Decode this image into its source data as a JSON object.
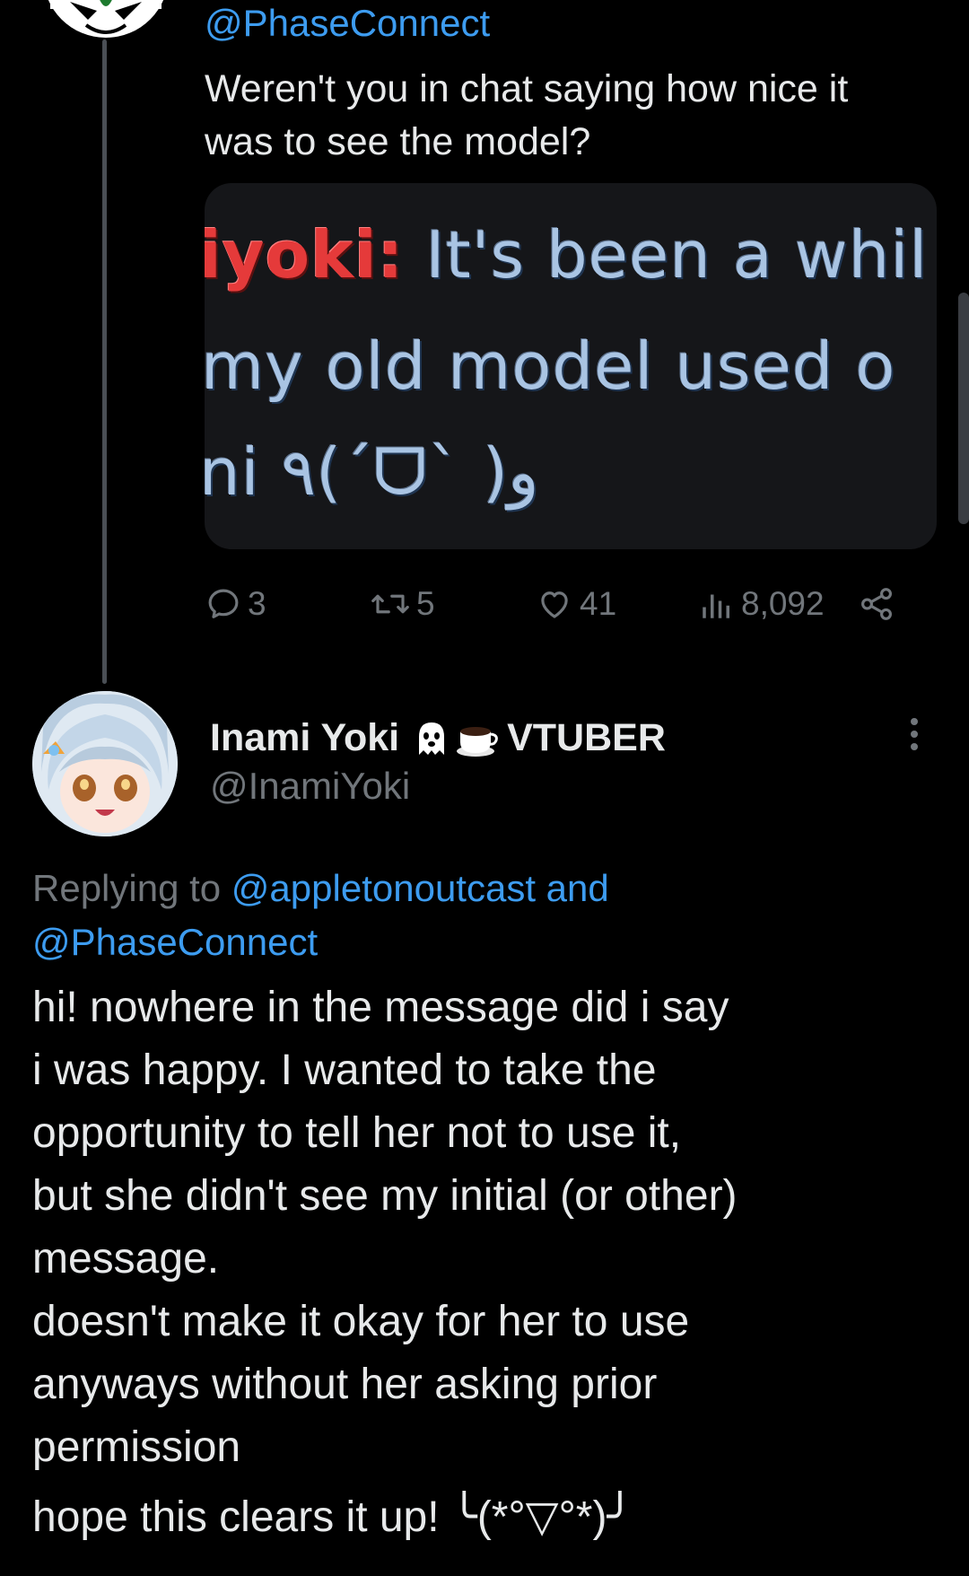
{
  "parent_tweet": {
    "handle": "@PhaseConnect",
    "text_lines": [
      "Weren't you in chat saying how nice it",
      "was to see the model?"
    ],
    "media": {
      "chat_name": "iyoki:",
      "line1_text": " It's been a whil",
      "line2_text": " my old model used o",
      "line3_text": "ni ٩(ˊᗜˋ )و"
    },
    "actions": {
      "replies": "3",
      "reposts": "5",
      "likes": "41",
      "views": "8,092"
    }
  },
  "reply_tweet": {
    "display_name": "Inami Yoki",
    "name_suffix": "VTUBER",
    "name_emojis": [
      "ghost-icon",
      "coffee-icon"
    ],
    "handle": "@InamiYoki",
    "replying_prefix": "Replying to ",
    "replying_to_1": "@appletonoutcast",
    "replying_and": " and",
    "replying_to_2": "@PhaseConnect",
    "text_lines": [
      "hi! nowhere in the message did i say",
      "i was happy. I wanted to take the",
      "opportunity to tell her not to use it,",
      "but she didn't see my initial (or other)",
      "message.",
      "doesn't make it okay for her to use",
      "anyways without her asking prior",
      "permission",
      "hope this clears it up!  ╰(*°▽°*)╯"
    ]
  },
  "colors": {
    "background": "#000000",
    "text_primary": "#e7e9ea",
    "text_secondary": "#71767b",
    "link": "#3d9cf0",
    "card_bg": "#151619",
    "chat_name": "#e53a3a"
  }
}
